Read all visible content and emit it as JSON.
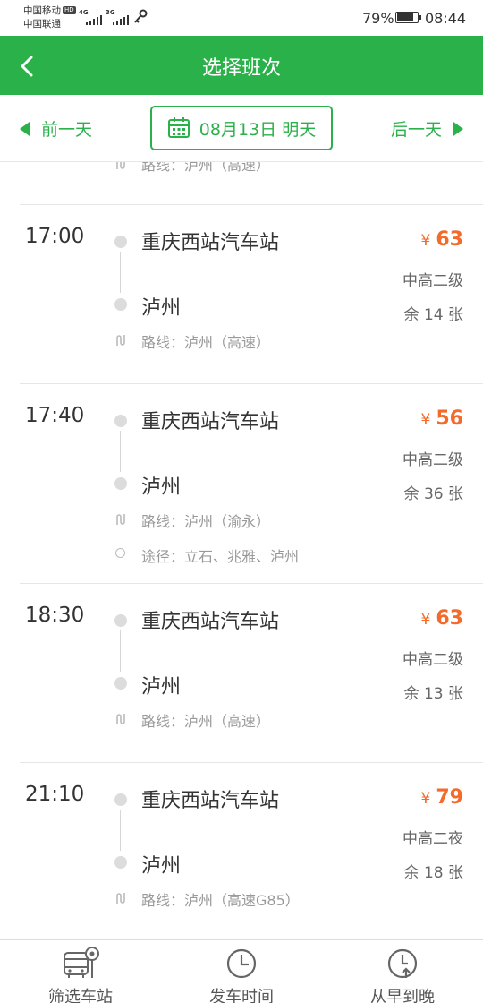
{
  "status": {
    "carrier1": "中国移动",
    "carrier1_badge": "HD",
    "carrier2": "中国联通",
    "net1": "4G",
    "net2": "3G",
    "battery": "79%",
    "time": "08:44"
  },
  "header": {
    "title": "选择班次"
  },
  "datebar": {
    "prev_label": "前一天",
    "date_label": "08月13日 明天",
    "next_label": "后一天"
  },
  "partial_route": "路线：泸州（高速）",
  "trips": [
    {
      "time": "17:00",
      "from": "重庆西站汽车站",
      "to": "泸州",
      "route": "路线：泸州（高速）",
      "price_symbol": "¥",
      "price": "63",
      "grade": "中高二级",
      "seats": "余 14 张"
    },
    {
      "time": "17:40",
      "from": "重庆西站汽车站",
      "to": "泸州",
      "route": "路线：泸州（渝永）",
      "via": "途径：立石、兆雅、泸州",
      "price_symbol": "¥",
      "price": "56",
      "grade": "中高二级",
      "seats": "余 36 张"
    },
    {
      "time": "18:30",
      "from": "重庆西站汽车站",
      "to": "泸州",
      "route": "路线：泸州（高速）",
      "price_symbol": "¥",
      "price": "63",
      "grade": "中高二级",
      "seats": "余 13 张"
    },
    {
      "time": "21:10",
      "from": "重庆西站汽车站",
      "to": "泸州",
      "route": "路线：泸州（高速G85）",
      "price_symbol": "¥",
      "price": "79",
      "grade": "中高二夜",
      "seats": "余 18 张"
    }
  ],
  "bottom_tabs": [
    {
      "label": "筛选车站",
      "icon": "bus-station-icon"
    },
    {
      "label": "发车时间",
      "icon": "clock-icon"
    },
    {
      "label": "从早到晚",
      "icon": "clock-up-arrow-icon"
    }
  ],
  "colors": {
    "accent": "#2bb14a",
    "price": "#f36a2a"
  }
}
